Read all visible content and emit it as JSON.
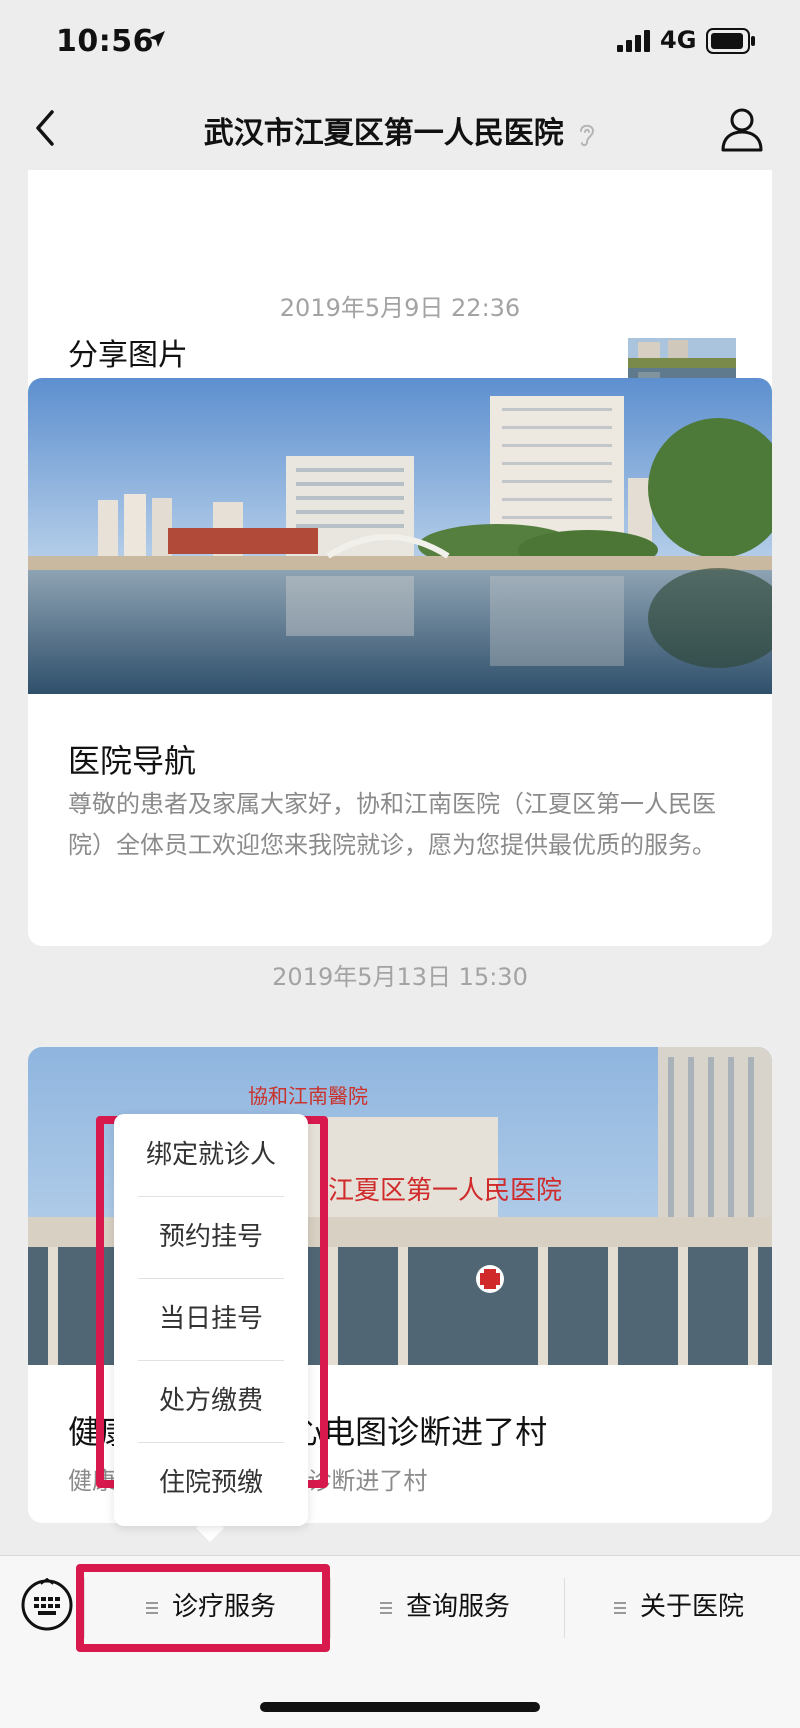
{
  "status_bar": {
    "time": "10:56",
    "network": "4G"
  },
  "nav": {
    "title": "武汉市江夏区第一人民医院"
  },
  "feed": {
    "top_card": {
      "title": "分享图片"
    },
    "timestamp_1": "2019年5月9日 22:36",
    "nav_card": {
      "title": "医院导航",
      "desc": "尊敬的患者及家属大家好，协和江南医院（江夏区第一人民医院）全体员工欢迎您来我院就诊，愿为您提供最优质的服务。"
    },
    "timestamp_2": "2019年5月13日 15:30",
    "health_card": {
      "title": "健康江夏 | 江夏心电图诊断进了村",
      "desc": "健康江夏 | 江夏心电图诊断进了村"
    }
  },
  "popup": {
    "items": [
      "绑定就诊人",
      "预约挂号",
      "当日挂号",
      "处方缴费",
      "住院预缴"
    ]
  },
  "menu": {
    "items": [
      "诊疗服务",
      "查询服务",
      "关于医院"
    ]
  },
  "colors": {
    "highlight": "#d8194e",
    "background": "#ededed"
  }
}
